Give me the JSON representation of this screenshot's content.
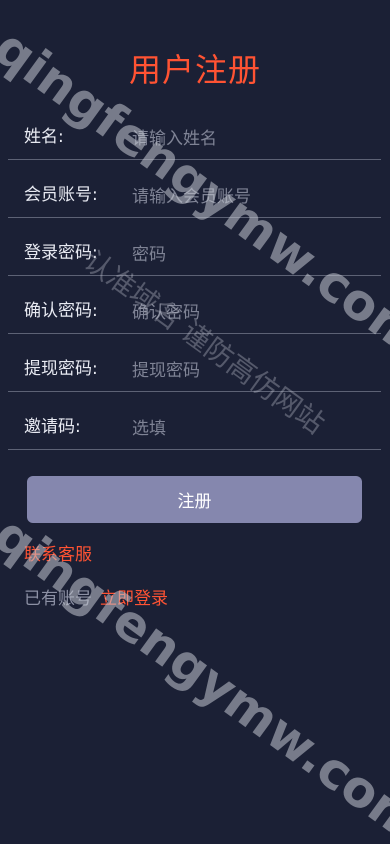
{
  "title": "用户注册",
  "fields": [
    {
      "label": "姓名:",
      "placeholder": "请输入姓名",
      "value": ""
    },
    {
      "label": "会员账号:",
      "placeholder": "请输入会员账号",
      "value": ""
    },
    {
      "label": "登录密码:",
      "placeholder": "密码",
      "value": ""
    },
    {
      "label": "确认密码:",
      "placeholder": "确认密码",
      "value": ""
    },
    {
      "label": "提现密码:",
      "placeholder": "提现密码",
      "value": ""
    },
    {
      "label": "邀请码:",
      "placeholder": "选填",
      "value": ""
    }
  ],
  "submit_label": "注册",
  "contact_link": "联系客服",
  "login_prompt": "已有账号",
  "login_link": "立即登录",
  "watermark_main": "qingfengymw.com",
  "watermark_sub": "认准域名 谨防高仿网站",
  "colors": {
    "background": "#1b2035",
    "accent": "#ff5333",
    "button": "#8587ae",
    "divider": "#5d6275"
  }
}
